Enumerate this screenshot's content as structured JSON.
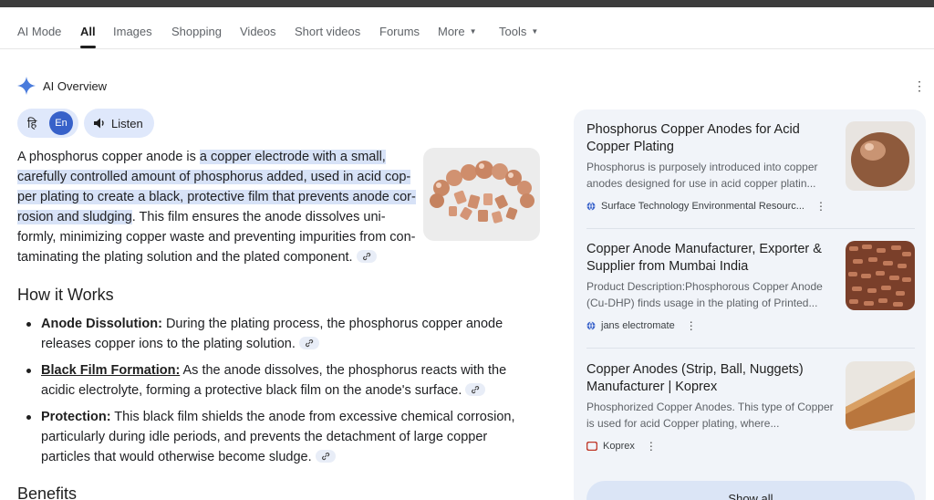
{
  "tabs": [
    {
      "label": "AI Mode"
    },
    {
      "label": "All"
    },
    {
      "label": "Images"
    },
    {
      "label": "Shopping"
    },
    {
      "label": "Videos"
    },
    {
      "label": "Short videos"
    },
    {
      "label": "Forums"
    },
    {
      "label": "More"
    },
    {
      "label": "Tools"
    }
  ],
  "overview": {
    "title": "AI Overview",
    "lang_hi": "हि",
    "lang_en": "En",
    "listen": "Listen",
    "para": {
      "pre": "A phosphorus copper anode is ",
      "highlight": "a copper electrode with a small, carefully controlled amount of phosphorus added, used in acid cop-per plating to create a black, protective film that prevents anode cor-rosion and sludging",
      "post": ". This film ensures the anode dissolves uni-formly, minimizing copper waste and preventing impurities from con-taminating the plating solution and the plated component."
    },
    "how_it_works": "How it Works",
    "bullets": [
      {
        "term": "Anode Dissolution:",
        "text": " During the plating process, the phosphorus copper anode releases copper ions to the plating solution."
      },
      {
        "term": "Black Film Formation:",
        "text": " As the anode dissolves, the phosphorus reacts with the acidic electrolyte, forming a protective black film on the anode's surface."
      },
      {
        "term": "Protection:",
        "text": " This black film shields the anode from excessive chemical corrosion, particularly during idle periods, and prevents the detachment of large copper particles that would otherwise become sludge."
      }
    ],
    "benefits": "Benefits"
  },
  "sources": [
    {
      "title": "Phosphorus Copper Anodes for Acid Copper Plating",
      "snippet": "Phosphorus is purposely introduced into copper anodes designed for use in acid copper platin...",
      "site": "Surface Technology Environmental Resourc..."
    },
    {
      "title": "Copper Anode Manufacturer, Exporter & Supplier from Mumbai India",
      "snippet": "Product Description:Phosphorous Copper Anode (Cu-DHP) finds usage in the plating of Printed...",
      "site": "jans electromate"
    },
    {
      "title": "Copper Anodes (Strip, Ball, Nuggets) Manufacturer | Koprex",
      "snippet": "Phosphorized Copper Anodes. This type of Copper is used for acid Copper plating, where...",
      "site": "Koprex"
    }
  ],
  "show_all": "Show all",
  "colors": {
    "accent": "#3761c9",
    "highlight": "#d7e2f7",
    "panel": "#f1f4f9"
  }
}
